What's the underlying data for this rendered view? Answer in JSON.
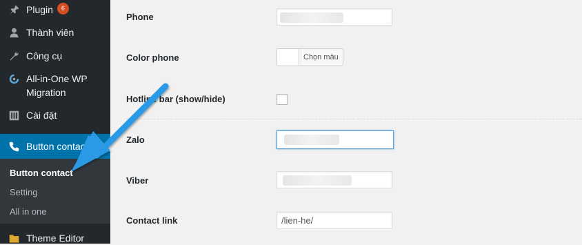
{
  "sidebar": {
    "items": [
      {
        "label": "Plugin",
        "badge": "6",
        "icon": "plugin-icon"
      },
      {
        "label": "Thành viên",
        "icon": "user-icon"
      },
      {
        "label": "Công cụ",
        "icon": "wrench-icon"
      },
      {
        "label": "All-in-One WP Migration",
        "icon": "migration-icon"
      },
      {
        "label": "Cài đặt",
        "icon": "settings-icon"
      },
      {
        "label": "Button contact",
        "icon": "phone-icon"
      },
      {
        "label": "Theme Editor",
        "icon": "folder-icon"
      }
    ],
    "submenu": [
      {
        "label": "Button contact"
      },
      {
        "label": "Setting"
      },
      {
        "label": "All in one"
      }
    ]
  },
  "form": {
    "phone_label": "Phone",
    "color_phone_label": "Color phone",
    "color_button_label": "Chọn màu",
    "hotline_bar_label": "Hotline bar (show/hide)",
    "zalo_label": "Zalo",
    "viber_label": "Viber",
    "contact_link_label": "Contact link",
    "contact_link_value": "/lien-he/"
  },
  "colors": {
    "sidebar_bg": "#23282d",
    "active_menu": "#0073aa",
    "arrow": "#2196f3"
  }
}
